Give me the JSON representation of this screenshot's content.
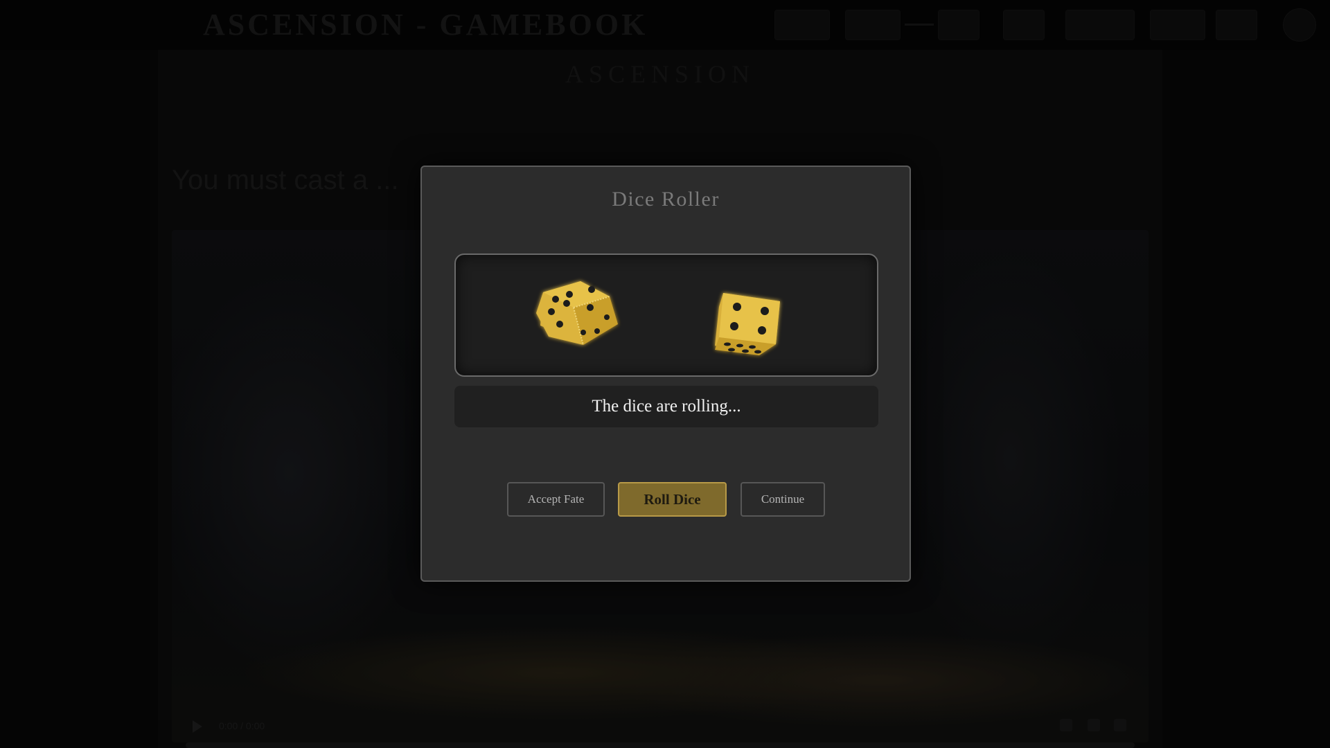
{
  "app": {
    "title": "ASCENSION - GAMEBOOK",
    "book_heading": "ASCENSION",
    "passage_text": "You must cast a ...",
    "nav_buttons": [
      "",
      "",
      "",
      "",
      "",
      "",
      "",
      ""
    ],
    "player": {
      "time": "0:00 / 0:00"
    }
  },
  "modal": {
    "title": "Dice Roller",
    "status": "The dice are rolling...",
    "dice": [
      {
        "name": "die-1",
        "visible_face": 5
      },
      {
        "name": "die-2",
        "visible_face": 4
      }
    ],
    "buttons": {
      "accept_label": "Accept Fate",
      "roll_label": "Roll Dice",
      "continue_label": "Continue"
    }
  },
  "colors": {
    "die_face": "#e0b83a",
    "die_side": "#b98f22",
    "pip": "#1a1a1a",
    "roll_button": "#7f6a2c",
    "modal_bg": "#2c2c2c"
  }
}
